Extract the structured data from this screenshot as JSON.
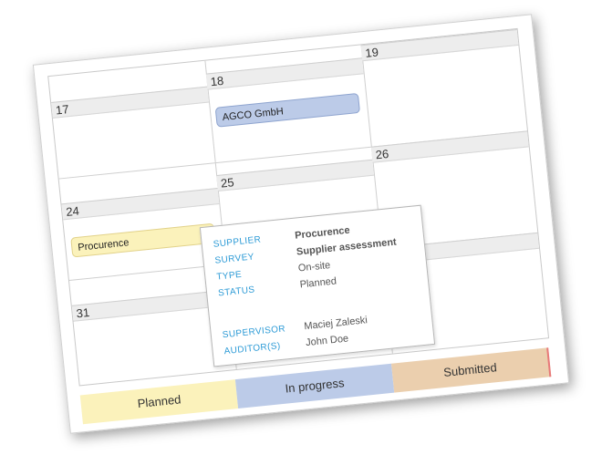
{
  "calendar": {
    "days": {
      "d17": "17",
      "d18": "18",
      "d19": "19",
      "d24": "24",
      "d25": "25",
      "d26": "26",
      "d31": "31"
    },
    "events": [
      {
        "label": "AGCO GmbH",
        "status": "In progress"
      },
      {
        "label": "Procurence",
        "status": "Planned"
      }
    ]
  },
  "popup": {
    "rows": [
      {
        "key": "SUPPLIER",
        "value": "Procurence"
      },
      {
        "key": "SURVEY",
        "value": "Supplier assessment"
      },
      {
        "key": "TYPE",
        "value": "On-site"
      },
      {
        "key": "STATUS",
        "value": "Planned"
      },
      {
        "key": "SUPERVISOR",
        "value": "Maciej Zaleski"
      },
      {
        "key": "AUDITOR(S)",
        "value": "John Doe"
      }
    ]
  },
  "legend": {
    "items": [
      {
        "label": "Planned",
        "color": "#fbf2bb"
      },
      {
        "label": "In progress",
        "color": "#bccbe8"
      },
      {
        "label": "Submitted",
        "color": "#ebcfae"
      }
    ]
  }
}
